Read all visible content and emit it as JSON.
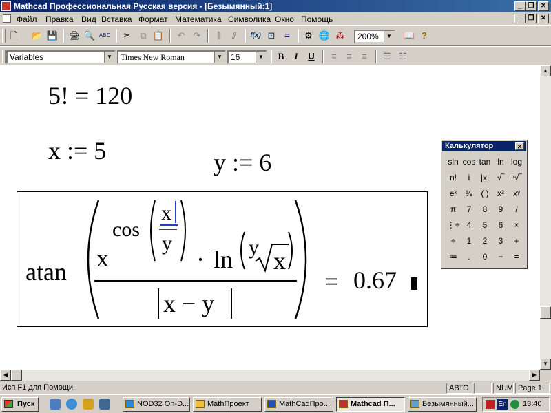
{
  "window": {
    "title": "Mathcad Профессиональная Русская версия - [Безымянный:1]",
    "controls": [
      "_",
      "❐",
      "✕"
    ]
  },
  "menu": [
    "Файл",
    "Правка",
    "Вид",
    "Вставка",
    "Формат",
    "Математика",
    "Символика",
    "Окно",
    "Помощь"
  ],
  "toolbar": {
    "zoom": "200%",
    "symbols": {
      "new": "🗋",
      "open": "📂",
      "save": "💾",
      "print": "🖨",
      "preview": "🔍",
      "spell": "ABC",
      "cut": "✂",
      "copy": "⧉",
      "paste": "📋",
      "undo": "↶",
      "redo": "↷",
      "function": "f(x)",
      "unit": "⊡",
      "equal": "=",
      "calc": "⊞",
      "resource": "📖",
      "help": "?"
    }
  },
  "format": {
    "style": "Variables",
    "font": "Times New Roman",
    "size": "16",
    "bold": "B",
    "italic": "I",
    "underline": "U"
  },
  "worksheet": {
    "line1": "5! = 120",
    "assign_x": "x := 5",
    "assign_y": "y := 6",
    "expr": {
      "atan": "atan",
      "x_base": "x",
      "cos": "cos",
      "frac_num": "x",
      "frac_den": "y",
      "dot": "·",
      "ln": "ln",
      "ln_y": "y",
      "root_x": "x",
      "denominator": "x − y",
      "equals": "=",
      "result": "0.67"
    }
  },
  "calculator": {
    "title": "Калькулятор",
    "close": "✕",
    "rows": [
      [
        "sin",
        "cos",
        "tan",
        "ln",
        "log"
      ],
      [
        "n!",
        "i",
        "|x|",
        "√‾",
        "ⁿ√‾"
      ],
      [
        "eˣ",
        "¹⁄ₓ",
        "( )",
        "x²",
        "xʸ"
      ],
      [
        "π",
        "7",
        "8",
        "9",
        "/"
      ],
      [
        "⋮÷",
        "4",
        "5",
        "6",
        "×"
      ],
      [
        "÷",
        "1",
        "2",
        "3",
        "+"
      ],
      [
        "≔",
        ".",
        "0",
        "−",
        "="
      ]
    ]
  },
  "status": {
    "help": "Исп F1 для Помощи.",
    "auto": "АВТО",
    "num": "NUM",
    "page": "Page 1"
  },
  "taskbar": {
    "start": "Пуск",
    "tasks": [
      "NOD32 On-D...",
      "MathПроект",
      "MathCadПро...",
      "Mathcad П...",
      "Безымянный..."
    ],
    "lang": "En",
    "clock": "13:40"
  }
}
